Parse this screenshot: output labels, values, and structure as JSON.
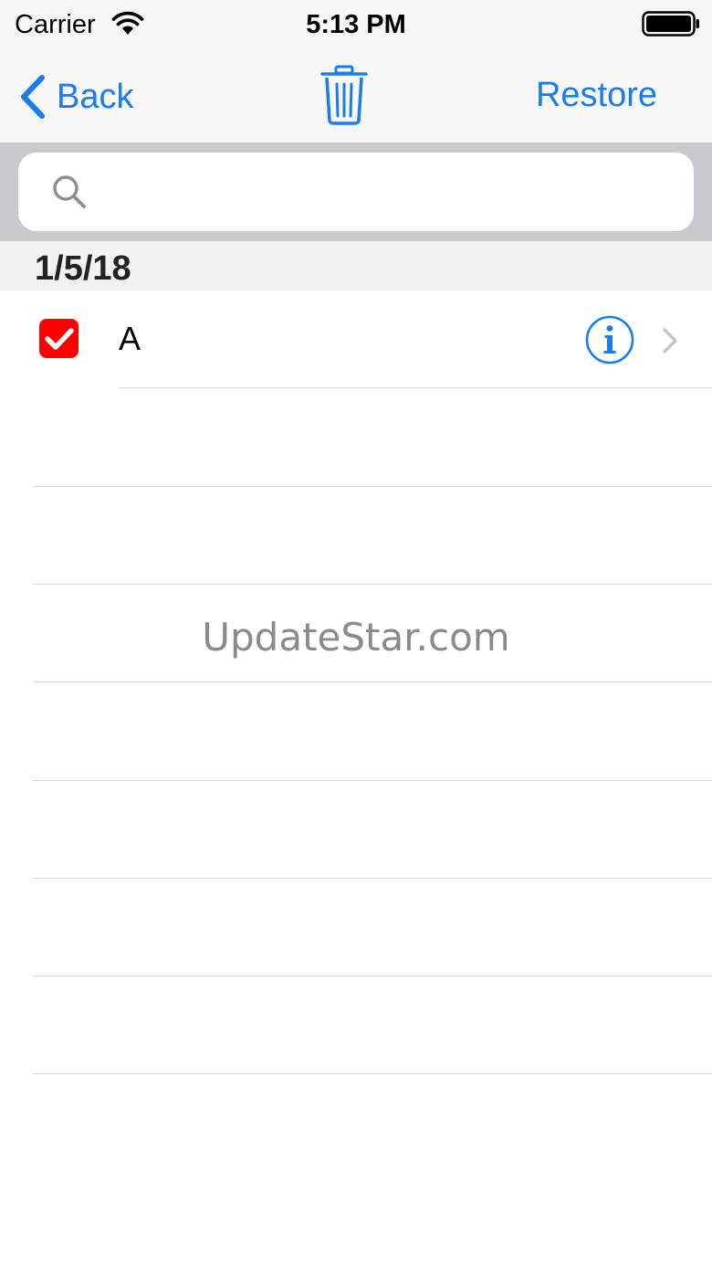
{
  "status_bar": {
    "carrier": "Carrier",
    "time": "5:13 PM",
    "wifi_icon": "wifi-icon",
    "battery_icon": "battery-full-icon"
  },
  "nav_bar": {
    "back_label": "Back",
    "back_icon": "chevron-left-icon",
    "trash_icon": "trash-icon",
    "restore_label": "Restore",
    "tint_color": "#1a7cf0"
  },
  "search": {
    "placeholder": "",
    "value": "",
    "icon": "search-icon"
  },
  "section": {
    "title": "1/5/18"
  },
  "list": {
    "items": [
      {
        "title": "A",
        "checked": true,
        "checkbox_color": "#ff0000",
        "info_icon": "info-icon",
        "disclosure_icon": "chevron-right-icon"
      }
    ]
  },
  "watermark": {
    "text": "UpdateStar.com"
  }
}
